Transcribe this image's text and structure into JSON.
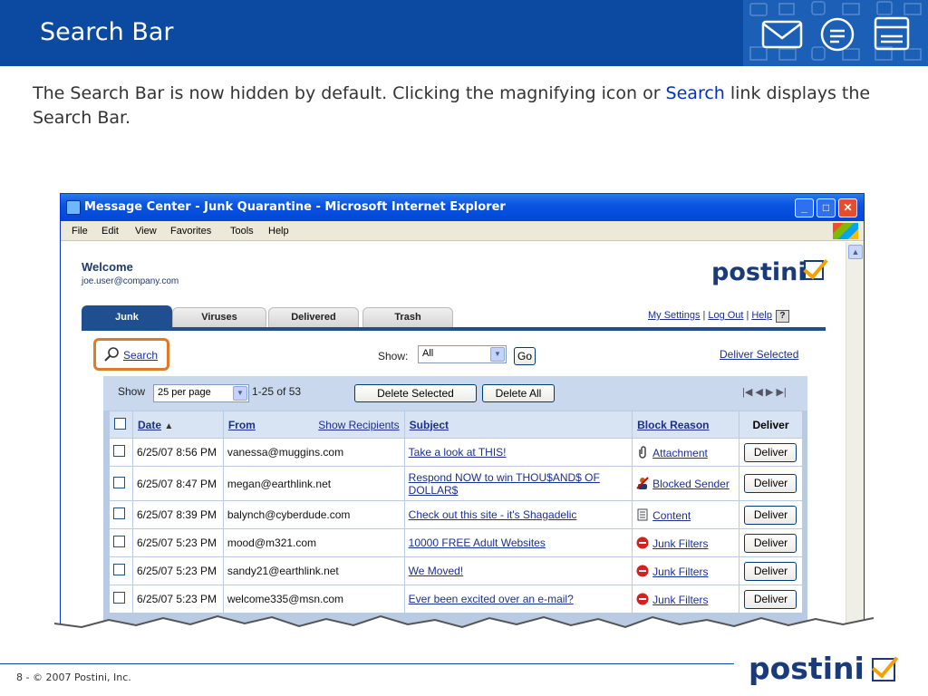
{
  "slide": {
    "title": "Search Bar",
    "intro_before": "The Search Bar is now hidden by default. Clicking the magnifying icon or ",
    "intro_link": "Search",
    "intro_after": " link displays the Search Bar.",
    "footer": "8 - © 2007 Postini, Inc.",
    "footer_logo": "postini"
  },
  "window": {
    "title": "Message Center - Junk Quarantine - Microsoft Internet Explorer",
    "menu": [
      "File",
      "Edit",
      "View",
      "Favorites",
      "Tools",
      "Help"
    ]
  },
  "app": {
    "welcome": "Welcome",
    "user_email": "joe.user@company.com",
    "logo": "postini",
    "tabs": [
      "Junk",
      "Viruses",
      "Delivered",
      "Trash"
    ],
    "active_tab": "Junk",
    "links": {
      "settings": "My Settings",
      "logout": "Log Out",
      "help": "Help",
      "help_icon": "?"
    },
    "search_link": "Search",
    "show_label": "Show:",
    "show_value": "All",
    "go_button": "Go",
    "deliver_selected": "Deliver Selected",
    "grid": {
      "show_label": "Show",
      "per_page": "25 per page",
      "range": "1-25 of 53",
      "delete_selected": "Delete Selected",
      "delete_all": "Delete All",
      "headers": {
        "date": "Date",
        "from": "From",
        "show_recipients": "Show Recipients",
        "subject": "Subject",
        "block_reason": "Block Reason",
        "deliver": "Deliver"
      },
      "rows": [
        {
          "date": "6/25/07 8:56 PM",
          "from": "vanessa@muggins.com",
          "subject": "Take a look at THIS!",
          "reason": "Attachment",
          "icon": "paperclip-icon",
          "deliver": "Deliver"
        },
        {
          "date": "6/25/07 8:47 PM",
          "from": "megan@earthlink.net",
          "subject": "Respond NOW to win THOU$AND$ OF DOLLAR$",
          "reason": "Blocked Sender",
          "icon": "person-icon",
          "deliver": "Deliver"
        },
        {
          "date": "6/25/07 8:39 PM",
          "from": "balynch@cyberdude.com",
          "subject": "Check out this site - it's Shagadelic",
          "reason": "Content",
          "icon": "document-icon",
          "deliver": "Deliver"
        },
        {
          "date": "6/25/07 5:23 PM",
          "from": "mood@m321.com",
          "subject": "10000 FREE Adult Websites",
          "reason": "Junk Filters",
          "icon": "stop-icon",
          "deliver": "Deliver"
        },
        {
          "date": "6/25/07 5:23 PM",
          "from": "sandy21@earthlink.net",
          "subject": "We Moved!",
          "reason": "Junk Filters",
          "icon": "stop-icon",
          "deliver": "Deliver"
        },
        {
          "date": "6/25/07 5:23 PM",
          "from": "welcome335@msn.com",
          "subject": "Ever been excited over an e-mail?",
          "reason": "Junk Filters",
          "icon": "stop-icon",
          "deliver": "Deliver"
        }
      ]
    }
  },
  "colors": {
    "header_blue": "#0b4aa0",
    "tab_active": "#1f4f8f",
    "highlight": "#e07a28",
    "link": "#1a2f8f"
  }
}
